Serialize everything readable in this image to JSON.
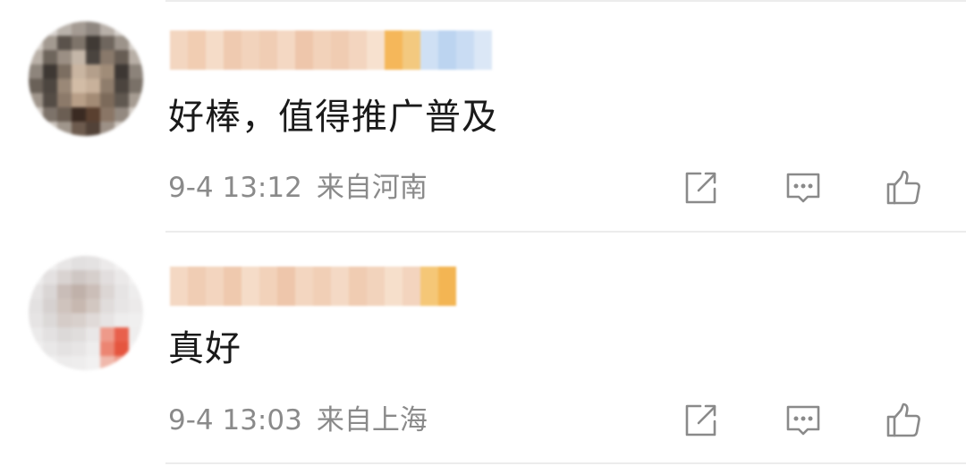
{
  "comments": [
    {
      "text": "好棒，值得推广普及",
      "time": "9-4 13:12",
      "location": "来自河南",
      "avatar_pixels": [
        "#e8e6e4",
        "#d9d4d0",
        "#b9b2ab",
        "#a49b93",
        "#8f8780",
        "#b8b0a9",
        "#d8d3ce",
        "#ebe9e7",
        "#d7d1cb",
        "#a39a91",
        "#5a524b",
        "#7e746a",
        "#403a35",
        "#6f665e",
        "#9c938a",
        "#d6d0ca",
        "#b9b0a7",
        "#6e655c",
        "#9b8f84",
        "#c4b6a8",
        "#4a443f",
        "#89796b",
        "#675d54",
        "#b8afa6",
        "#8e857c",
        "#3e3833",
        "#7c6e61",
        "#c9b5a1",
        "#b49f8b",
        "#a08c78",
        "#3d3733",
        "#8c837a",
        "#6a6158",
        "#4d4640",
        "#9a8877",
        "#d2bca6",
        "#c8b19b",
        "#8f7d6c",
        "#4b443e",
        "#7a7168",
        "#9f958b",
        "#544c45",
        "#8c7a6a",
        "#b89f88",
        "#a38b75",
        "#7c6a5a",
        "#605850",
        "#a69c92",
        "#cfc8c1",
        "#7d736a",
        "#6b5e53",
        "#3a2a22",
        "#5a4030",
        "#8a7666",
        "#938980",
        "#d2cbc4",
        "#ece9e6",
        "#cbc4bd",
        "#a0968c",
        "#6d5b4e",
        "#524238",
        "#9d9187",
        "#cdc6bf",
        "#eceae7"
      ],
      "name_pixels": [
        "#f3d6c0",
        "#f1cdb2",
        "#f5dcc8",
        "#efcab0",
        "#f2d3bc",
        "#f0cdb4",
        "#f4d8c3",
        "#eec6ab",
        "#f2d2ba",
        "#f0ccb2",
        "#f3d5bf",
        "#f7e1cf",
        "#f5b75a",
        "#f3c97f",
        "#cfe0f4",
        "#bcd4f0",
        "#c9dcf3",
        "#dbe7f6"
      ]
    },
    {
      "text": "真好",
      "time": "9-4 13:03",
      "location": "来自上海",
      "avatar_pixels": [
        "#f4f3f3",
        "#efeeee",
        "#e8e6e6",
        "#e2e0e0",
        "#e4e2e2",
        "#eceaea",
        "#f2f1f1",
        "#f6f5f5",
        "#eeeded",
        "#e4e1e1",
        "#d9d3d1",
        "#cfc7c4",
        "#d6cfcc",
        "#e2dede",
        "#ebe9e9",
        "#f3f2f2",
        "#e7e5e5",
        "#dad6d5",
        "#c9bdb8",
        "#c0b1aa",
        "#cbbeb8",
        "#dcd6d4",
        "#e6e4e4",
        "#eeeded",
        "#e3e1e1",
        "#d6d1d0",
        "#cfc3bd",
        "#c7b8b0",
        "#d2c7c1",
        "#e0dcdb",
        "#e7e5e5",
        "#eceaea",
        "#e6e4e4",
        "#dcd9d8",
        "#d5ccc8",
        "#d8d0cc",
        "#e0dad8",
        "#e7e4e4",
        "#eeeded",
        "#f0efef",
        "#ebeaea",
        "#e3e1e1",
        "#dcd9d8",
        "#e0dddc",
        "#e9e7e7",
        "#ee9a8a",
        "#e8604c",
        "#efeeee",
        "#f0efef",
        "#e9e8e8",
        "#e4e2e2",
        "#e7e5e5",
        "#eeeded",
        "#ec8572",
        "#e5553f",
        "#f2f1f1",
        "#f5f4f4",
        "#f1f0f0",
        "#edecec",
        "#eeeded",
        "#f2f1f1",
        "#f0b8ab",
        "#ee9d8d",
        "#f6f5f5"
      ],
      "name_pixels": [
        "#f4d8c3",
        "#f0cdb4",
        "#f3d5bf",
        "#efc9ae",
        "#f5dcc8",
        "#f2d2ba",
        "#eec6ab",
        "#f3d6c0",
        "#f1cfb6",
        "#f4d9c5",
        "#f0ccb2",
        "#f2d3bc",
        "#f6dfcb",
        "#f3d4be",
        "#f5c777",
        "#f3b553"
      ]
    }
  ],
  "actions": {
    "share": "share-icon",
    "reply": "comment-icon",
    "like": "thumbs-up-icon",
    "color": "#8a8a8a"
  }
}
